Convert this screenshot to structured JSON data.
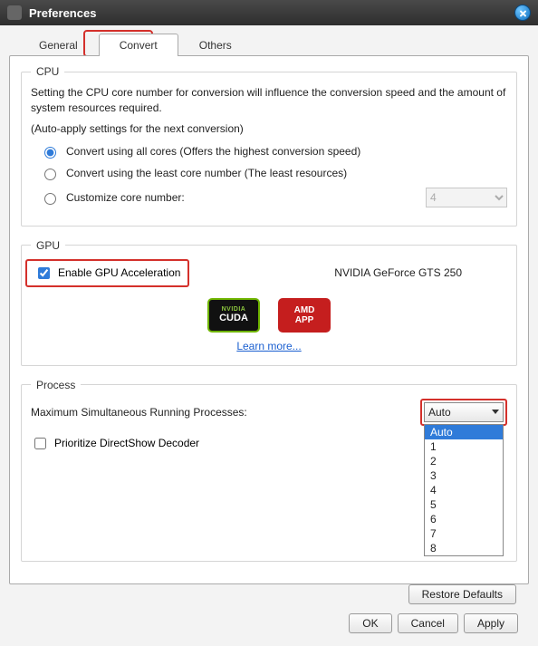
{
  "titlebar": {
    "title": "Preferences"
  },
  "tabs": {
    "items": [
      "General",
      "Convert",
      "Others"
    ],
    "active": 1
  },
  "cpu": {
    "legend": "CPU",
    "desc": "Setting the CPU core number for conversion will influence the conversion speed and the amount of system resources required.",
    "note": "(Auto-apply settings for the next conversion)",
    "opt_all": "Convert using all cores (Offers the highest conversion speed)",
    "opt_least": "Convert using the least core number (The least resources)",
    "opt_custom": "Customize core number:",
    "core_value": "4"
  },
  "gpu": {
    "legend": "GPU",
    "enable_label": "Enable GPU Acceleration",
    "device": "NVIDIA GeForce GTS 250",
    "nvidia_top": "NVIDIA",
    "nvidia_bot": "CUDA",
    "amd_top": "AMD",
    "amd_bot": "APP",
    "learn": "Learn more..."
  },
  "process": {
    "legend": "Process",
    "max_label": "Maximum Simultaneous Running Processes:",
    "selected": "Auto",
    "options": [
      "Auto",
      "1",
      "2",
      "3",
      "4",
      "5",
      "6",
      "7",
      "8"
    ],
    "ds_label": "Prioritize DirectShow Decoder"
  },
  "buttons": {
    "restore": "Restore Defaults",
    "ok": "OK",
    "cancel": "Cancel",
    "apply": "Apply"
  }
}
